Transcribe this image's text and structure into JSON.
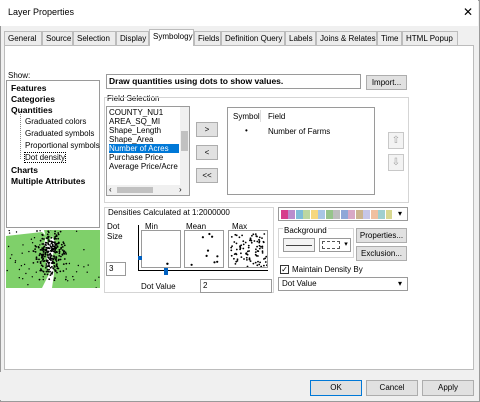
{
  "window": {
    "title": "Layer Properties",
    "close": "✕"
  },
  "tabs": [
    "General",
    "Source",
    "Selection",
    "Display",
    "Symbology",
    "Fields",
    "Definition Query",
    "Labels",
    "Joins & Relates",
    "Time",
    "HTML Popup"
  ],
  "active_tab": "Symbology",
  "show": {
    "label": "Show:",
    "items": [
      {
        "label": "Features",
        "bold": true
      },
      {
        "label": "Categories",
        "bold": true
      },
      {
        "label": "Quantities",
        "bold": true
      },
      {
        "label": "Graduated colors",
        "bold": false
      },
      {
        "label": "Graduated symbols",
        "bold": false
      },
      {
        "label": "Proportional symbols",
        "bold": false
      },
      {
        "label": "Dot density",
        "bold": false
      },
      {
        "label": "Charts",
        "bold": true
      },
      {
        "label": "Multiple Attributes",
        "bold": true
      }
    ],
    "selected": "Dot density"
  },
  "description": "Draw quantities using dots to show values.",
  "import_button": "Import...",
  "field_selection": {
    "label": "Field Selection",
    "fields": [
      "COUNTY_NU1",
      "AREA_SQ_MI",
      "Shape_Length",
      "Shape_Area",
      "Number of Acres",
      "Purchase Price",
      "Average Price/Acre"
    ],
    "selected": "Number of Acres",
    "move_right": ">",
    "move_left": "<",
    "move_all_left": "<<",
    "table_headers": {
      "symbol": "Symbol",
      "field": "Field"
    },
    "table_rows": [
      {
        "symbol": "•",
        "field": "Number of Farms"
      }
    ],
    "up": "⇧",
    "down": "⇩"
  },
  "densities": {
    "label": "Densities Calculated at 1:2000000",
    "dot_size_label": "Dot\nSize",
    "dot_size_value": "3",
    "min_label": "Min",
    "mean_label": "Mean",
    "max_label": "Max",
    "dot_value_label": "Dot Value",
    "dot_value": "2"
  },
  "color_ramp": [
    "#d63c8c",
    "#b98ccd",
    "#7fbcd8",
    "#bcd7a1",
    "#f6d77f",
    "#a8c6e4",
    "#96c48a",
    "#bdbdbd",
    "#8fa7d8",
    "#d8a8c6",
    "#cbb48f",
    "#c6c6e8",
    "#f0c0a0",
    "#9fcfcf",
    "#d8d890"
  ],
  "background": {
    "label": "Background"
  },
  "properties_button": "Properties...",
  "exclusion_button": "Exclusion...",
  "maintain_density": {
    "label": "Maintain Density By",
    "checked": "✓"
  },
  "maintain_option": "Dot Value",
  "buttons": {
    "ok": "OK",
    "cancel": "Cancel",
    "apply": "Apply"
  }
}
